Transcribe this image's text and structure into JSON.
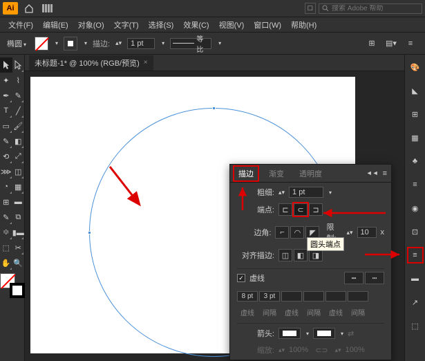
{
  "topbar": {
    "logo": "Ai",
    "search_placeholder": "搜索 Adobe 帮助"
  },
  "menu": {
    "file": "文件(F)",
    "edit": "编辑(E)",
    "object": "对象(O)",
    "type": "文字(T)",
    "select": "选择(S)",
    "effect": "效果(C)",
    "view": "视图(V)",
    "window": "窗口(W)",
    "help": "帮助(H)"
  },
  "control": {
    "shape": "椭圆",
    "stroke_label": "描边:",
    "weight": "1 pt",
    "profile": "等比"
  },
  "tab": {
    "title": "未标题-1* @ 100% (RGB/预览)"
  },
  "stroke_panel": {
    "tab_stroke": "描边",
    "tab_gradient": "渐变",
    "tab_transparency": "透明度",
    "weight_label": "粗细:",
    "weight": "1 pt",
    "cap_label": "端点:",
    "corner_label": "边角:",
    "limit_label": "限制:",
    "limit": "10",
    "limit_x": "x",
    "align_label": "对齐描边:",
    "dash_label": "虚线",
    "dash_vals": [
      "8 pt",
      "3 pt",
      "",
      "",
      "",
      ""
    ],
    "dash_names": [
      "虚线",
      "间隔",
      "虚线",
      "间隔",
      "虚线",
      "间隔"
    ],
    "arrow_label": "箭头:",
    "scale_label": "缩放:",
    "scale1": "100%",
    "scale2": "100%",
    "tooltip": "圆头端点"
  }
}
